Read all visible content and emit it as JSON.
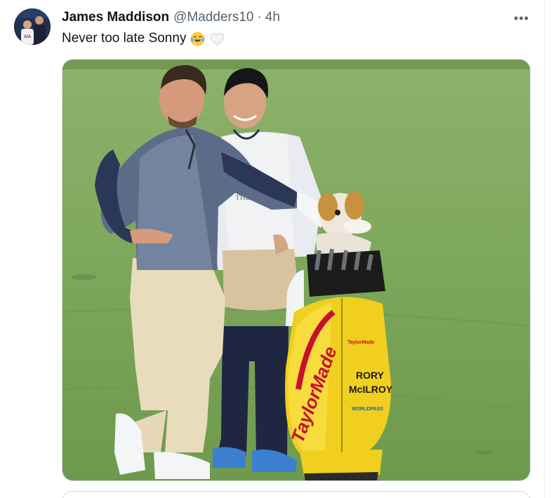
{
  "tweet": {
    "author": {
      "display_name": "James Maddison",
      "handle": "@Madders10",
      "avatar_icon": "profile-photo"
    },
    "separator": "·",
    "timestamp": "4h",
    "text": "Never too late Sonny",
    "emojis": [
      "face-with-tears-of-joy",
      "white-heart"
    ],
    "more_label": "•••",
    "media": {
      "kind": "photo",
      "description_icon": "golf-course-photo",
      "bag_label_brand": "TaylorMade",
      "bag_label_small": "TaylorMade",
      "bag_label_name_1": "RORY",
      "bag_label_name_2": "McILROY",
      "bag_label_sponsor": "WORLDPASS",
      "bib_text": "THE"
    }
  },
  "colors": {
    "text_primary": "#0f1419",
    "text_secondary": "#536471",
    "border": "#cfd9de",
    "grass": "#7aa553"
  }
}
